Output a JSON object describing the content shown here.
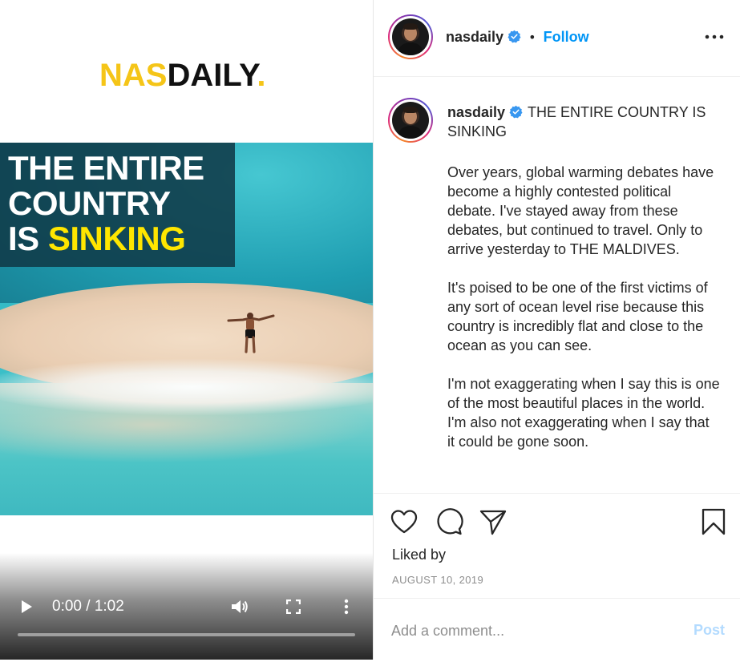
{
  "media": {
    "logo": {
      "part1": "NAS",
      "part2": "DAILY",
      "dot": "."
    },
    "banner": {
      "line1": "THE ENTIRE",
      "line2": "COUNTRY",
      "line3_prefix": "IS ",
      "line3_highlight": "SINKING"
    },
    "video": {
      "time": "0:00 / 1:02",
      "progress": 0.0,
      "icons": [
        "play-icon",
        "volume-icon",
        "fullscreen-icon",
        "more-vert-icon"
      ]
    },
    "colors": {
      "logo_yellow": "#f5c518",
      "highlight_yellow": "#ffe600",
      "banner_bg": "#103a48"
    }
  },
  "header": {
    "username": "nasdaily",
    "separator": "•",
    "follow_label": "Follow",
    "verified_icon": "verified-badge-icon",
    "more_icon": "more-horizontal-icon"
  },
  "caption": {
    "username": "nasdaily",
    "title": "THE ENTIRE COUNTRY IS SINKING",
    "paragraphs": [
      "Over years, global warming debates have become a highly contested political debate. I've stayed away from these debates, but continued to travel. Only to arrive yesterday to THE MALDIVES.",
      "It's poised to be one of the first victims of any sort of ocean level rise because this country is incredibly flat and close to the ocean as you can see.",
      "I'm not exaggerating when I say this is one of the most beautiful places in the world.",
      "I'm also not exaggerating when I say that it could be gone soon."
    ]
  },
  "actions": {
    "icons": [
      "heart-icon",
      "comment-icon",
      "share-icon",
      "bookmark-icon"
    ],
    "liked_by": "Liked by",
    "date": "AUGUST 10, 2019"
  },
  "comment": {
    "placeholder": "Add a comment...",
    "post_label": "Post",
    "colors": {
      "link_blue": "#0095f6",
      "post_disabled": "#b3dbff"
    }
  }
}
